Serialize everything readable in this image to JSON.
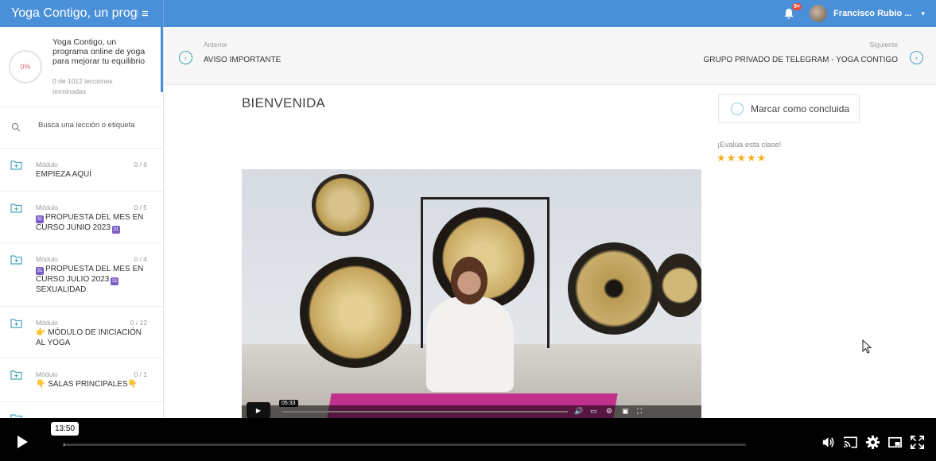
{
  "topbar": {
    "course_title": "Yoga Contigo, un progr",
    "menu_icon": "menu-icon",
    "notifications_badge": "9+",
    "user_name": "Francisco Rubio ..."
  },
  "sidebar": {
    "progress_percent": "0%",
    "course_title": "Yoga Contigo, un programa online de yoga para mejorar tu equilibrio",
    "lessons_done": "0 de 1012 lecciones terminadas",
    "search_placeholder": "Busca una lección o etiqueta",
    "modules": [
      {
        "kind": "Módulo",
        "count": "0 / 6",
        "title": "EMPIEZA AQUÍ"
      },
      {
        "kind": "Módulo",
        "count": "0 / 5",
        "title_pre": "",
        "title": "PROPUESTA DEL MES EN CURSO JUNIO 2023"
      },
      {
        "kind": "Módulo",
        "count": "0 / 4",
        "title": "PROPUESTA DEL MES EN CURSO JULIO 2023",
        "title_post": "SEXUALIDAD"
      },
      {
        "kind": "Módulo",
        "count": "0 / 12",
        "title": "👉 MÓDULO DE INICIACIÓN AL YOGA"
      },
      {
        "kind": "Módulo",
        "count": "0 / 1",
        "title": "👇 SALAS PRINCIPALES👇"
      }
    ]
  },
  "lesson_nav": {
    "prev_label": "Anterior",
    "prev_title": "AVISO IMPORTANTE",
    "next_label": "Siguiente",
    "next_title": "GRUPO PRIVADO DE TELEGRAM - YOGA CONTIGO"
  },
  "lesson": {
    "title": "BIENVENIDA",
    "mark_complete": "Marcar como concluida",
    "rate_label": "¡Evalúa esta clase!",
    "stars": 5,
    "embedded_time": "05:33"
  },
  "player": {
    "hover_time": "13:50",
    "progress": 0.0
  },
  "colors": {
    "topbar": "#4a90d9",
    "accent": "#4aa3b8",
    "star": "#f2b01e"
  }
}
